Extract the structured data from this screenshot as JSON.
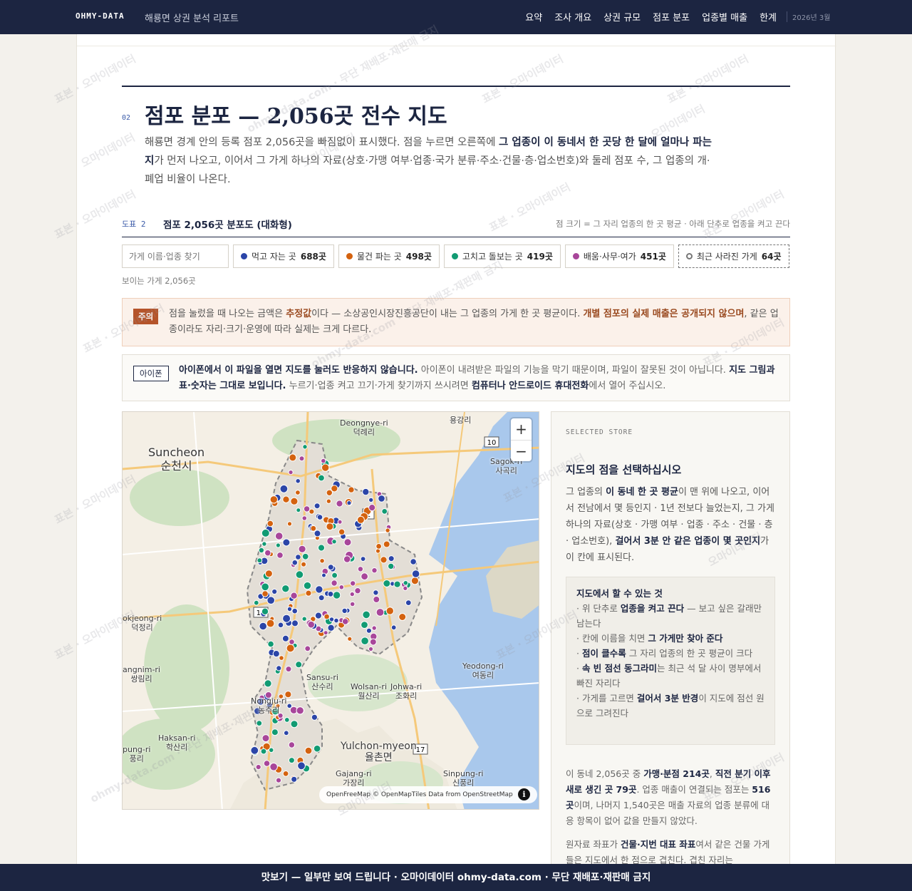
{
  "topbar": {
    "brand": "OHMY-DATA",
    "report_title": "해룡면 상권 분석 리포트",
    "nav": [
      "요약",
      "조사 개요",
      "상권 규모",
      "점포 분포",
      "업종별 매출",
      "한계"
    ],
    "date": "2026년 3월"
  },
  "section": {
    "number": "02",
    "title": "점포 분포 — 2,056곳 전수 지도",
    "desc_1": "해룡면 경계 안의 등록 점포 2,056곳을 빠짐없이 표시했다. 점을 누르면 오른쪽에 ",
    "desc_bold": "그 업종이 이 동네서 한 곳당 한 달에 얼마나 파는지",
    "desc_2": "가 먼저 나오고, 이어서 그 가게 하나의 자료(상호·가맹 여부·업종·국가 분류·주소·건물·층·업소번호)와 둘레 점포 수, 그 업종의 개·폐업 비율이 나온다."
  },
  "figure": {
    "label": "도표 2",
    "title": "점포 2,056곳 분포도 (대화형)",
    "note": "점 크기 = 그 자리 업종의 한 곳 평균 · 아래 단추로 업종을 켜고 끈다"
  },
  "filters": {
    "search_placeholder": "가게 이름·업종 찾기",
    "chips": [
      {
        "label": "먹고 자는 곳",
        "count": "688곳",
        "color": "#2b45a8"
      },
      {
        "label": "물건 파는 곳",
        "count": "498곳",
        "color": "#d4620f"
      },
      {
        "label": "고치고 돌보는 곳",
        "count": "419곳",
        "color": "#119b73"
      },
      {
        "label": "배움·사무·여가",
        "count": "451곳",
        "color": "#a8469a"
      }
    ],
    "closed_chip": {
      "label": "최근 사라진 가게",
      "count": "64곳"
    },
    "visible_count": "보이는 가게 2,056곳"
  },
  "caution": {
    "tag": "주의",
    "t1": "점을 눌렀을 때 나오는 금액은 ",
    "b1": "추정값",
    "t2": "이다 — 소상공인시장진흥공단이 내는 그 업종의 가게 한 곳 평균이다. ",
    "b2": "개별 점포의 실제 매출은 공개되지 않으며",
    "t3": ", 같은 업종이라도 자리·크기·운영에 따라 실제는 크게 다르다."
  },
  "iphone": {
    "tag": "아이폰",
    "b1": "아이폰에서 이 파일을 열면 지도를 눌러도 반응하지 않습니다.",
    "t1": " 아이폰이 내려받은 파일의 기능을 막기 때문이며, 파일이 잘못된 것이 아닙니다. ",
    "b2": "지도 그림과 표·숫자는 그대로 보입니다.",
    "t2": " 누르기·업종 켜고 끄기·가게 찾기까지 쓰시려면 ",
    "b3": "컴퓨터나 안드로이드 휴대전화",
    "t3": "에서 열어 주십시오."
  },
  "map": {
    "zoom_in": "+",
    "zoom_out": "−",
    "attribution": "OpenFreeMap © OpenMapTiles Data from OpenStreetMap",
    "info": "i",
    "places": {
      "suncheon_en": "Suncheon",
      "suncheon_ko": "순천시",
      "deongnye_en": "Deongnye-ri",
      "deongnye_ko": "덕례리",
      "yonggang_ko": "용강리",
      "sagok_en": "Sagok-ri",
      "sagok_ko": "사곡리",
      "bokjeong_en": "okjeong-ri",
      "bokjeong_ko": "덕정리",
      "sangnim_en": "angnim-ri",
      "sangnim_ko": "쌍림리",
      "sansu_en": "Sansu-ri",
      "sansu_ko": "산수리",
      "wolsan_en": "Wolsan-ri",
      "wolsan_ko": "월산리",
      "johwa_en": "Johwa-ri",
      "johwa_ko": "조화리",
      "yeodong_en": "Yeodong-ri",
      "yeodong_ko": "여동리",
      "nongju_en": "Nongju-ri",
      "nongju_ko": "농주리",
      "haksan_en": "Haksan-ri",
      "haksan_ko": "학산리",
      "pungri_en": "pung-ri",
      "pungri_ko": "풍리",
      "yulchon_en": "Yulchon-myeon",
      "yulchon_ko": "율촌면",
      "gajang_en": "Gajang-ri",
      "gajang_ko": "가장리",
      "sinpung_en": "Sinpung-ri",
      "sinpung_ko": "신풍리",
      "route_10": "10",
      "route_2": "2",
      "route_17": "17",
      "route_10b": "10"
    }
  },
  "side": {
    "eyebrow": "SELECTED STORE",
    "title": "지도의 점을 선택하십시오",
    "intro_1": "그 업종의 ",
    "intro_b1": "이 동네 한 곳 평균",
    "intro_2": "이 맨 위에 나오고, 이어서 전남에서 몇 등인지 · 1년 전보다 늘었는지, 그 가게 하나의 자료(상호 · 가맹 여부 · 업종 · 주소 · 건물 · 층 · 업소번호), ",
    "intro_b2": "걸어서 3분 안 같은 업종이 몇 곳인지",
    "intro_3": "가 이 칸에 표시된다.",
    "howto_title": "지도에서 할 수 있는 것",
    "howto": [
      {
        "pre": "· 위 단추로 ",
        "b": "업종을 켜고 끈다",
        "post": " — 보고 싶은 갈래만 남는다"
      },
      {
        "pre": "· 칸에 이름을 치면 ",
        "b": "그 가게만 찾아 준다",
        "post": ""
      },
      {
        "pre": "· ",
        "b": "점이 클수록",
        "post": " 그 자리 업종의 한 곳 평균이 크다"
      },
      {
        "pre": "· ",
        "b": "속 빈 점선 동그라미",
        "post": "는 최근 석 달 사이 명부에서 빠진 자리다"
      },
      {
        "pre": "· 가게를 고르면 ",
        "b": "걸어서 3분 반경",
        "post": "이 지도에 점선 원으로 그려진다"
      }
    ],
    "stat1_a": "이 동네 2,056곳 중 ",
    "stat1_b1": "가맹·분점 214곳",
    "stat1_c": ", ",
    "stat1_b2": "직전 분기 이후 새로 생긴 곳 79곳",
    "stat1_d": ". 업종 매출이 연결되는 점포는 ",
    "stat1_b3": "516곳",
    "stat1_e": "이며, 나머지 1,540곳은 매출 자료의 업종 분류에 대응 항목이 없어 값을 만들지 않았다.",
    "stat2_a": "원자료 좌표가 ",
    "stat2_b": "건물·지번 대표 좌표",
    "stat2_c": "여서 같은 건물 가게들은 지도에서 한 점으로 겹친다. 겹친 자리는"
  },
  "watermark": {
    "w1": "표본 · 오마이데이터",
    "w2": "ohmy-data.com · 무단 재배포·재판매 금지",
    "w3": "오마이데이터"
  },
  "footer": "맛보기 — 일부만 보여 드립니다 · 오마이데이터 ohmy-data.com · 무단 재배포·재판매 금지"
}
